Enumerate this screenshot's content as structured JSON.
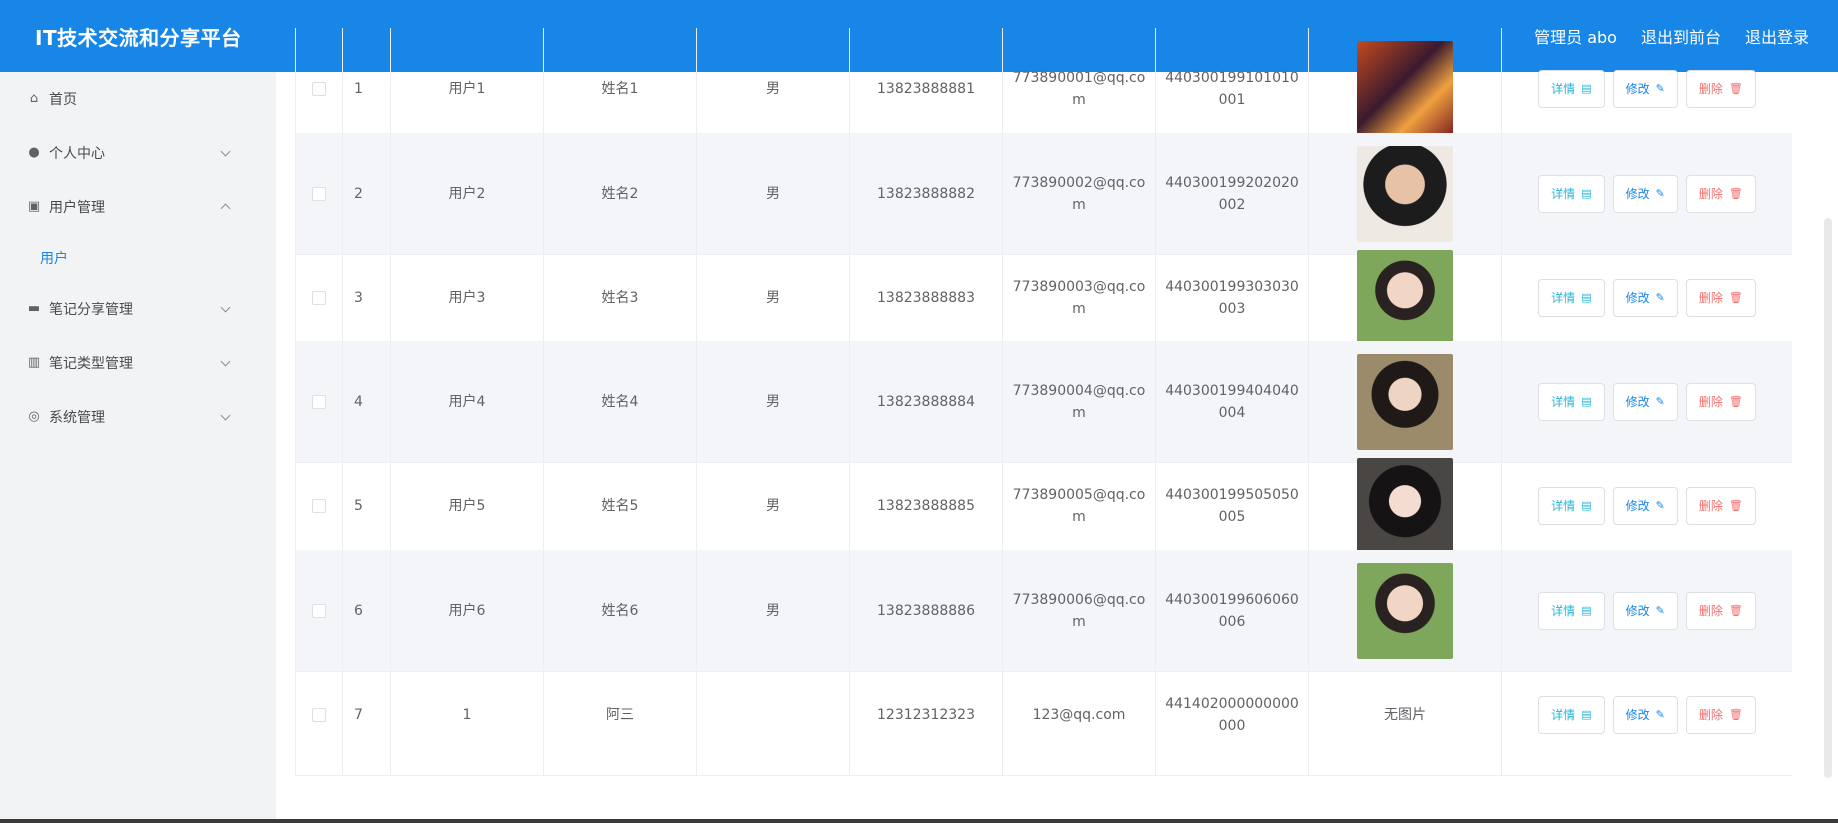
{
  "header": {
    "title": "IT技术交流和分享平台",
    "admin": "管理员 abo",
    "to_front": "退出到前台",
    "logout": "退出登录"
  },
  "sidebar": {
    "items": [
      {
        "label": "首页",
        "icon": "home-icon"
      },
      {
        "label": "个人中心",
        "icon": "user-icon"
      },
      {
        "label": "用户管理",
        "icon": "clipboard-icon"
      },
      {
        "label": "笔记分享管理",
        "icon": "briefcase-icon"
      },
      {
        "label": "笔记类型管理",
        "icon": "library-icon"
      },
      {
        "label": "系统管理",
        "icon": "compass-icon"
      }
    ],
    "sub_user": "用户"
  },
  "buttons": {
    "detail": "详情",
    "edit": "修改",
    "delete": "删除"
  },
  "rows": [
    {
      "idx": "1",
      "user": "用户1",
      "name": "姓名1",
      "sex": "男",
      "phone": "13823888881",
      "email": "773890001@qq.com",
      "idcard": "440300199101010001",
      "photo": ""
    },
    {
      "idx": "2",
      "user": "用户2",
      "name": "姓名2",
      "sex": "男",
      "phone": "13823888882",
      "email": "773890002@qq.com",
      "idcard": "440300199202020002",
      "photo": ""
    },
    {
      "idx": "3",
      "user": "用户3",
      "name": "姓名3",
      "sex": "男",
      "phone": "13823888883",
      "email": "773890003@qq.com",
      "idcard": "440300199303030003",
      "photo": ""
    },
    {
      "idx": "4",
      "user": "用户4",
      "name": "姓名4",
      "sex": "男",
      "phone": "13823888884",
      "email": "773890004@qq.com",
      "idcard": "440300199404040004",
      "photo": ""
    },
    {
      "idx": "5",
      "user": "用户5",
      "name": "姓名5",
      "sex": "男",
      "phone": "13823888885",
      "email": "773890005@qq.com",
      "idcard": "440300199505050005",
      "photo": ""
    },
    {
      "idx": "6",
      "user": "用户6",
      "name": "姓名6",
      "sex": "男",
      "phone": "13823888886",
      "email": "773890006@qq.com",
      "idcard": "440300199606060006",
      "photo": ""
    },
    {
      "idx": "7",
      "user": "1",
      "name": "阿三",
      "sex": "",
      "phone": "12312312323",
      "email": "123@qq.com",
      "idcard": "441402000000000000",
      "photo": "无图片"
    }
  ],
  "colors": {
    "primary": "#1886e6",
    "danger": "#f56c6c",
    "info": "#26b5d6"
  }
}
